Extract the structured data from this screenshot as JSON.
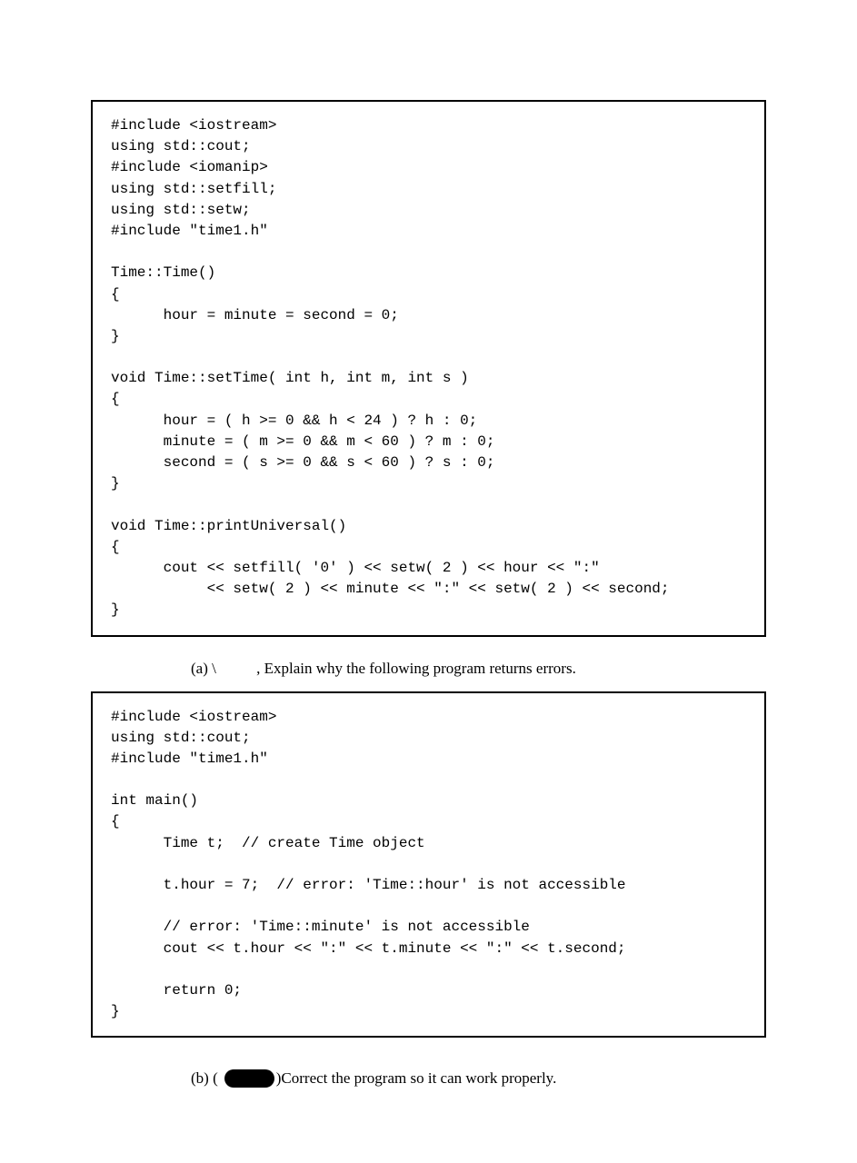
{
  "codeBox1": "#include <iostream>\nusing std::cout;\n#include <iomanip>\nusing std::setfill;\nusing std::setw;\n#include \"time1.h\"\n\nTime::Time()\n{\n      hour = minute = second = 0;\n}\n\nvoid Time::setTime( int h, int m, int s )\n{\n      hour = ( h >= 0 && h < 24 ) ? h : 0;\n      minute = ( m >= 0 && m < 60 ) ? m : 0;\n      second = ( s >= 0 && s < 60 ) ? s : 0;\n}\n\nvoid Time::printUniversal()\n{\n      cout << setfill( '0' ) << setw( 2 ) << hour << \":\"\n           << setw( 2 ) << minute << \":\" << setw( 2 ) << second;\n}",
  "questionA": {
    "label": "(a)  \\",
    "text": ", Explain why the following program returns errors."
  },
  "codeBox2": "#include <iostream>\nusing std::cout;\n#include \"time1.h\"\n\nint main()\n{\n      Time t;  // create Time object\n\n      t.hour = 7;  // error: 'Time::hour' is not accessible\n\n      // error: 'Time::minute' is not accessible\n      cout << t.hour << \":\" << t.minute << \":\" << t.second;\n\n      return 0;\n}",
  "questionB": {
    "labelPrefix": "(b)  (",
    "labelSuffix": ")",
    "text": " Correct the program so it can work properly."
  }
}
